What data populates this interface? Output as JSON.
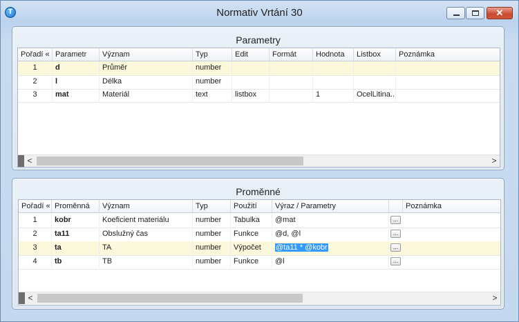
{
  "window": {
    "title": "Normativ Vrtání 30",
    "app_icon_glyph": "T",
    "min_glyph": "",
    "close_glyph": "✕"
  },
  "parametry": {
    "title": "Parametry",
    "columns": [
      "Pořadí «",
      "Parametr",
      "Význam",
      "Typ",
      "Edit",
      "Formát",
      "Hodnota",
      "Listbox",
      "Poznámka"
    ],
    "rows": [
      {
        "poradi": "1",
        "parametr": "d",
        "vyznam": "Průměr",
        "typ": "number",
        "edit": "",
        "format": "",
        "hodnota": "",
        "listbox": "",
        "poznamka": ""
      },
      {
        "poradi": "2",
        "parametr": "l",
        "vyznam": "Délka",
        "typ": "number",
        "edit": "",
        "format": "",
        "hodnota": "",
        "listbox": "",
        "poznamka": ""
      },
      {
        "poradi": "3",
        "parametr": "mat",
        "vyznam": "Materiál",
        "typ": "text",
        "edit": "listbox",
        "format": "",
        "hodnota": "1",
        "listbox": "OcelLitina...",
        "poznamka": ""
      }
    ],
    "scroll_left": "<",
    "scroll_right": ">"
  },
  "promenne": {
    "title": "Proměnné",
    "columns": [
      "Pořadí «",
      "Proměnná",
      "Význam",
      "Typ",
      "Použití",
      "Výraz / Parametry",
      "",
      "Poznámka"
    ],
    "rows": [
      {
        "poradi": "1",
        "promenna": "kobr",
        "vyznam": "Koeficient materiálu",
        "typ": "number",
        "pouziti": "Tabulka",
        "vyraz": "@mat",
        "btn": "...",
        "poznamka": ""
      },
      {
        "poradi": "2",
        "promenna": "ta11",
        "vyznam": "Obslužný čas",
        "typ": "number",
        "pouziti": "Funkce",
        "vyraz": "@d, @l",
        "btn": "...",
        "poznamka": ""
      },
      {
        "poradi": "3",
        "promenna": "ta",
        "vyznam": "TA",
        "typ": "number",
        "pouziti": "Výpočet",
        "vyraz": "@ta11 * @kobr",
        "btn": "...",
        "poznamka": ""
      },
      {
        "poradi": "4",
        "promenna": "tb",
        "vyznam": "TB",
        "typ": "number",
        "pouziti": "Funkce",
        "vyraz": "@l",
        "btn": "...",
        "poznamka": ""
      }
    ],
    "scroll_left": "<",
    "scroll_right": ">"
  },
  "colors": {
    "selected_row": "#fbf8dc",
    "text_highlight": "#3399ff",
    "close_button": "#c84a2e"
  }
}
